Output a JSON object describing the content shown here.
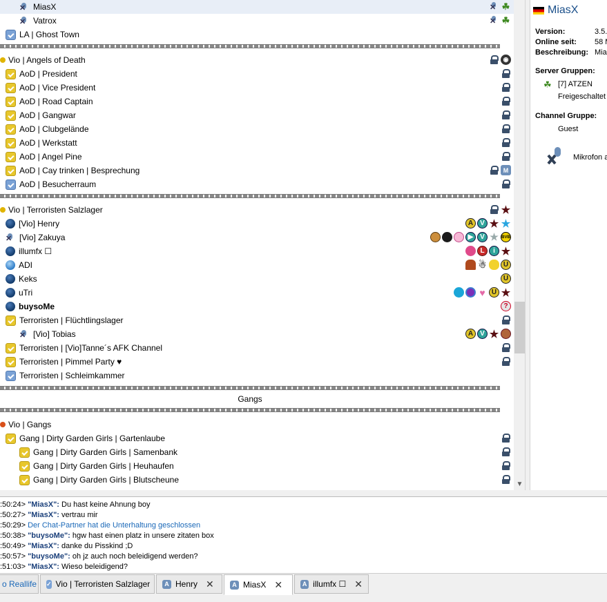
{
  "tree": {
    "rows": [
      {
        "label": "MiasX",
        "type": "mute",
        "indent": 28,
        "selected": true,
        "rights": [
          "mutes",
          "leaf"
        ]
      },
      {
        "label": "Vatrox",
        "type": "mute",
        "indent": 28,
        "rights": [
          "mutes",
          "leaf"
        ]
      },
      {
        "label": "LA | Ghost Town",
        "type": "chanblue",
        "indent": 8,
        "rights": []
      }
    ],
    "section_angels": {
      "spacer": "Vio | Angels of Death",
      "channels": [
        {
          "label": "AoD | President",
          "rights": [
            "lock"
          ]
        },
        {
          "label": "AoD | Vice President",
          "rights": [
            "lock"
          ]
        },
        {
          "label": "AoD | Road Captain",
          "rights": [
            "lock"
          ]
        },
        {
          "label": "AoD | Gangwar",
          "rights": [
            "lock"
          ]
        },
        {
          "label": "AoD | Clubgelände",
          "rights": [
            "lock"
          ]
        },
        {
          "label": "AoD | Werkstatt",
          "rights": [
            "lock"
          ]
        },
        {
          "label": "AoD | Angel Pine",
          "rights": [
            "lock"
          ]
        },
        {
          "label": "AoD | Cay trinken | Besprechung",
          "rights": [
            "lock",
            "m"
          ]
        },
        {
          "label": "AoD | Besucherraum",
          "rights": [
            "lock"
          ]
        }
      ]
    },
    "section_terror": {
      "spacer": "Vio | Terroristen Salzlager",
      "users": [
        {
          "label": "[Vio] Henry",
          "type": "user"
        },
        {
          "label": "[Vio] Zakuya",
          "type": "mute"
        },
        {
          "label": "illumfx ☐",
          "type": "user"
        },
        {
          "label": "ADI",
          "type": "userlight"
        },
        {
          "label": "Keks",
          "type": "user"
        },
        {
          "label": "uTri",
          "type": "user"
        },
        {
          "label": "buysoMe",
          "type": "user",
          "bold": true
        }
      ],
      "channels": [
        {
          "label": "Terroristen | Flüchtlingslager",
          "type": "chan"
        },
        {
          "label": "[Vio] Tobias",
          "type": "mute"
        },
        {
          "label": "Terroristen | [Vio]Tanne´s AFK Channel",
          "type": "chan"
        },
        {
          "label": "Terroristen | Pimmel Party ♥",
          "type": "chan"
        },
        {
          "label": "Terroristen | Schleimkammer",
          "type": "chanblue"
        }
      ]
    },
    "gangs_spacer": "Gangs",
    "section_gangs": {
      "spacer": "Vio | Gangs",
      "channels": [
        {
          "label": "Gang | Dirty Garden Girls | Gartenlaube"
        },
        {
          "label": "Gang | Dirty Garden Girls | Samenbank"
        },
        {
          "label": "Gang | Dirty Garden Girls | Heuhaufen"
        },
        {
          "label": "Gang | Dirty Garden Girls | Blutscheune"
        }
      ]
    }
  },
  "info": {
    "name": "MiasX",
    "version_label": "Version:",
    "version_value": "3.5.",
    "online_label": "Online seit:",
    "online_value": "58 M",
    "desc_label": "Beschreibung:",
    "desc_value": "Mias",
    "server_groups_label": "Server Gruppen:",
    "server_group": "[7] ATZEN",
    "server_group_status": "Freigeschaltet",
    "channel_group_label": "Channel Gruppe:",
    "channel_group": "Guest",
    "mic_text": "Mikrofon a"
  },
  "chat": [
    {
      "ts": ":50:24>",
      "nick": "\"MiasX\":",
      "msg": " Du hast keine Ahnung boy"
    },
    {
      "ts": ":50:27>",
      "nick": "\"MiasX\":",
      "msg": " vertrau mir"
    },
    {
      "ts": ":50:29>",
      "sys": " Der Chat-Partner hat die Unterhaltung geschlossen"
    },
    {
      "ts": ":50:38>",
      "nick": "\"buysoMe\":",
      "msg": " hgw hast einen platz in unsere zitaten box"
    },
    {
      "ts": ":50:49>",
      "nick": "\"MiasX\":",
      "msg": " danke du Pisskind ;D"
    },
    {
      "ts": ":50:57>",
      "nick": "\"buysoMe\":",
      "msg": " oh jz auch noch beleidigend werden?"
    },
    {
      "ts": ":51:03>",
      "nick": "\"MiasX\":",
      "msg": " Wieso beleidigend?"
    }
  ],
  "tabs": [
    {
      "label": "o Reallife",
      "link": true
    },
    {
      "label": "Vio | Terroristen Salzlager",
      "icon": "channel"
    },
    {
      "label": "Henry",
      "icon": "A",
      "close": "✕"
    },
    {
      "label": "MiasX",
      "icon": "A",
      "close": "✕",
      "active": true
    },
    {
      "label": "illumfx ☐",
      "icon": "A",
      "close": "✕"
    }
  ]
}
